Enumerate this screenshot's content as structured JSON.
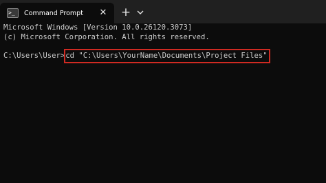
{
  "tab": {
    "icon": "command-prompt-icon",
    "icon_glyph": ">_",
    "title": "Command Prompt",
    "close_glyph": "✕"
  },
  "new_tab": {
    "glyph": "+"
  },
  "terminal": {
    "lines": [
      "Microsoft Windows [Version 10.0.26120.3073]",
      "(c) Microsoft Corporation. All rights reserved."
    ],
    "prompt": "C:\\Users\\User>",
    "command": "cd \"C:\\Users\\YourName\\Documents\\Project Files\""
  },
  "colors": {
    "background": "#0c0c0c",
    "titlebar": "#202020",
    "text": "#cccccc",
    "highlight": "#d02a22"
  }
}
